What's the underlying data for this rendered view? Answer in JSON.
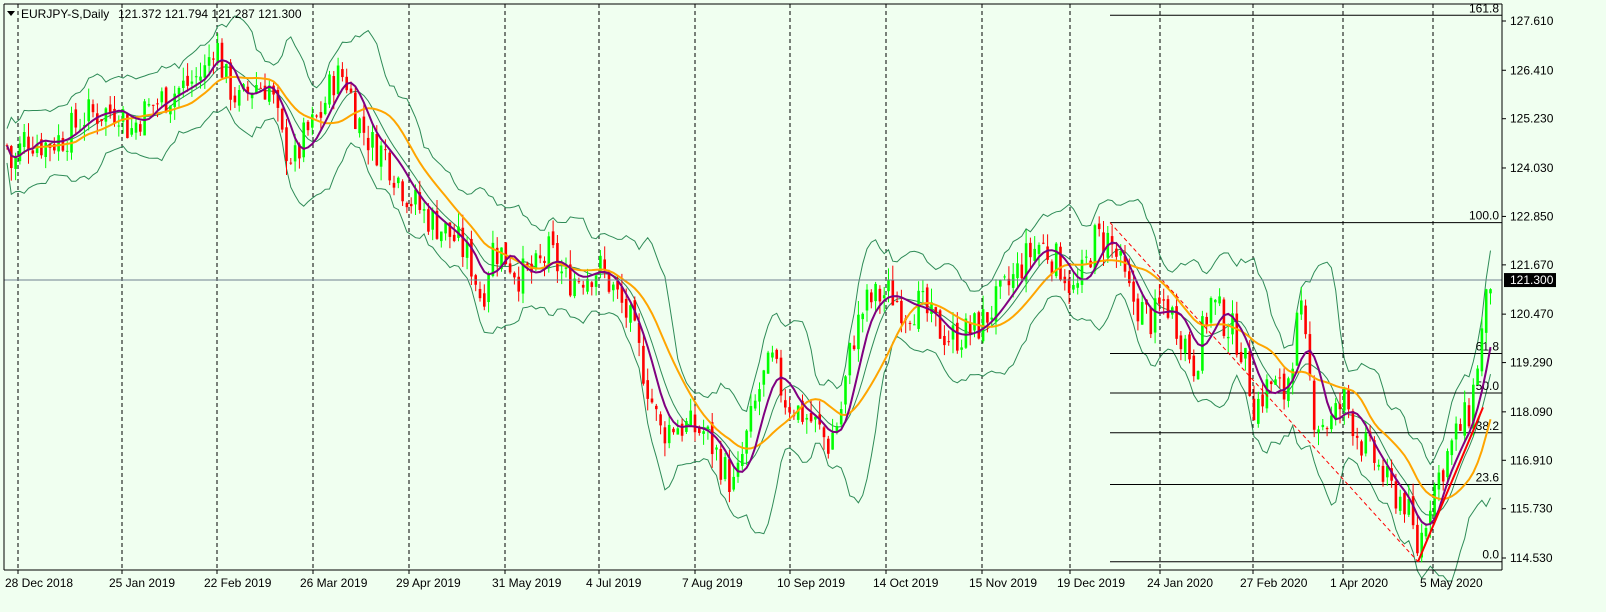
{
  "header": {
    "symbol_tf": "EURJPY-S,Daily",
    "ohlc": "121.372 121.794 121.287 121.300"
  },
  "colors": {
    "background": "#f0fff0",
    "bull": "#00ff00",
    "bear": "#ff0000",
    "ma_fast": "#800080",
    "ma_slow": "#ffa500",
    "bollinger": "#2e8b57",
    "grid": "#000000",
    "price_line": "#708090",
    "fib_line": "#000000",
    "price_tag_bg": "#000000",
    "price_tag_text": "#ffffff"
  },
  "chart_data": {
    "type": "candlestick",
    "symbol": "EURJPY-S",
    "timeframe": "Daily",
    "ylim": [
      114.0,
      128.3
    ],
    "y_ticks": [
      "127.610",
      "126.410",
      "125.230",
      "124.030",
      "122.850",
      "121.670",
      "120.470",
      "119.290",
      "118.090",
      "116.910",
      "115.730",
      "114.530"
    ],
    "x_ticks": [
      "28 Dec 2018",
      "25 Jan 2019",
      "22 Feb 2019",
      "26 Mar 2019",
      "29 Apr 2019",
      "31 May 2019",
      "4 Jul 2019",
      "7 Aug 2019",
      "10 Sep 2019",
      "14 Oct 2019",
      "15 Nov 2019",
      "19 Dec 2019",
      "24 Jan 2020",
      "27 Feb 2020",
      "1 Apr 2020",
      "5 May 2020"
    ],
    "current_price": "121.300",
    "close_path": [
      [
        0,
        127.0
      ],
      [
        5,
        124.8
      ],
      [
        12,
        124.0
      ],
      [
        25,
        124.8
      ],
      [
        45,
        124.6
      ],
      [
        65,
        124.8
      ],
      [
        85,
        125.3
      ],
      [
        105,
        125.4
      ],
      [
        120,
        125.5
      ],
      [
        130,
        124.9
      ],
      [
        140,
        125.3
      ],
      [
        155,
        125.6
      ],
      [
        175,
        125.9
      ],
      [
        190,
        126.1
      ],
      [
        205,
        126.4
      ],
      [
        215,
        127.2
      ],
      [
        225,
        126.2
      ],
      [
        240,
        125.6
      ],
      [
        255,
        126.1
      ],
      [
        270,
        126.0
      ],
      [
        282,
        124.7
      ],
      [
        295,
        124.2
      ],
      [
        305,
        124.8
      ],
      [
        320,
        125.3
      ],
      [
        333,
        126.2
      ],
      [
        345,
        126.3
      ],
      [
        358,
        125.2
      ],
      [
        372,
        124.6
      ],
      [
        385,
        124.4
      ],
      [
        395,
        123.9
      ],
      [
        410,
        123.3
      ],
      [
        425,
        122.9
      ],
      [
        440,
        122.6
      ],
      [
        455,
        122.3
      ],
      [
        470,
        121.8
      ],
      [
        482,
        120.8
      ],
      [
        492,
        122.1
      ],
      [
        505,
        121.9
      ],
      [
        520,
        121.4
      ],
      [
        535,
        121.5
      ],
      [
        550,
        122.0
      ],
      [
        565,
        121.3
      ],
      [
        580,
        121.4
      ],
      [
        600,
        121.6
      ],
      [
        615,
        121.0
      ],
      [
        630,
        120.3
      ],
      [
        645,
        119.0
      ],
      [
        660,
        117.6
      ],
      [
        675,
        117.8
      ],
      [
        690,
        117.7
      ],
      [
        705,
        117.6
      ],
      [
        720,
        116.9
      ],
      [
        735,
        116.2
      ],
      [
        745,
        117.3
      ],
      [
        760,
        118.7
      ],
      [
        772,
        119.3
      ],
      [
        785,
        118.4
      ],
      [
        800,
        118.1
      ],
      [
        815,
        117.8
      ],
      [
        828,
        117.3
      ],
      [
        840,
        118.0
      ],
      [
        852,
        119.8
      ],
      [
        865,
        120.7
      ],
      [
        878,
        120.9
      ],
      [
        890,
        121.0
      ],
      [
        905,
        120.6
      ],
      [
        920,
        120.7
      ],
      [
        935,
        120.2
      ],
      [
        950,
        119.9
      ],
      [
        965,
        120.0
      ],
      [
        980,
        120.2
      ],
      [
        995,
        120.7
      ],
      [
        1010,
        121.2
      ],
      [
        1025,
        121.8
      ],
      [
        1040,
        122.2
      ],
      [
        1055,
        121.8
      ],
      [
        1065,
        121.5
      ],
      [
        1075,
        120.9
      ],
      [
        1085,
        121.6
      ],
      [
        1095,
        122.3
      ],
      [
        1108,
        122.3
      ],
      [
        1118,
        121.8
      ],
      [
        1128,
        121.0
      ],
      [
        1140,
        120.6
      ],
      [
        1152,
        120.3
      ],
      [
        1165,
        120.8
      ],
      [
        1180,
        120.1
      ],
      [
        1195,
        119.2
      ],
      [
        1210,
        120.8
      ],
      [
        1225,
        120.3
      ],
      [
        1240,
        119.8
      ],
      [
        1255,
        118.2
      ],
      [
        1270,
        118.8
      ],
      [
        1285,
        118.5
      ],
      [
        1300,
        120.6
      ],
      [
        1315,
        117.9
      ],
      [
        1330,
        117.8
      ],
      [
        1345,
        118.4
      ],
      [
        1360,
        117.4
      ],
      [
        1375,
        116.9
      ],
      [
        1390,
        116.2
      ],
      [
        1405,
        115.9
      ],
      [
        1418,
        114.7
      ],
      [
        1430,
        116.0
      ],
      [
        1445,
        116.9
      ],
      [
        1458,
        117.6
      ],
      [
        1470,
        118.1
      ],
      [
        1480,
        119.7
      ],
      [
        1490,
        121.3
      ]
    ],
    "fibonacci": [
      {
        "level": "161.8",
        "price": 127.75
      },
      {
        "level": "100.0",
        "price": 122.7
      },
      {
        "level": "61.8",
        "price": 119.51
      },
      {
        "level": "50.0",
        "price": 118.55
      },
      {
        "level": "38.2",
        "price": 117.58
      },
      {
        "level": "23.6",
        "price": 116.32
      },
      {
        "level": "0.0",
        "price": 114.44
      }
    ],
    "indicators": [
      "Moving Average (fast)",
      "Moving Average (slow)",
      "Bollinger Bands"
    ]
  }
}
